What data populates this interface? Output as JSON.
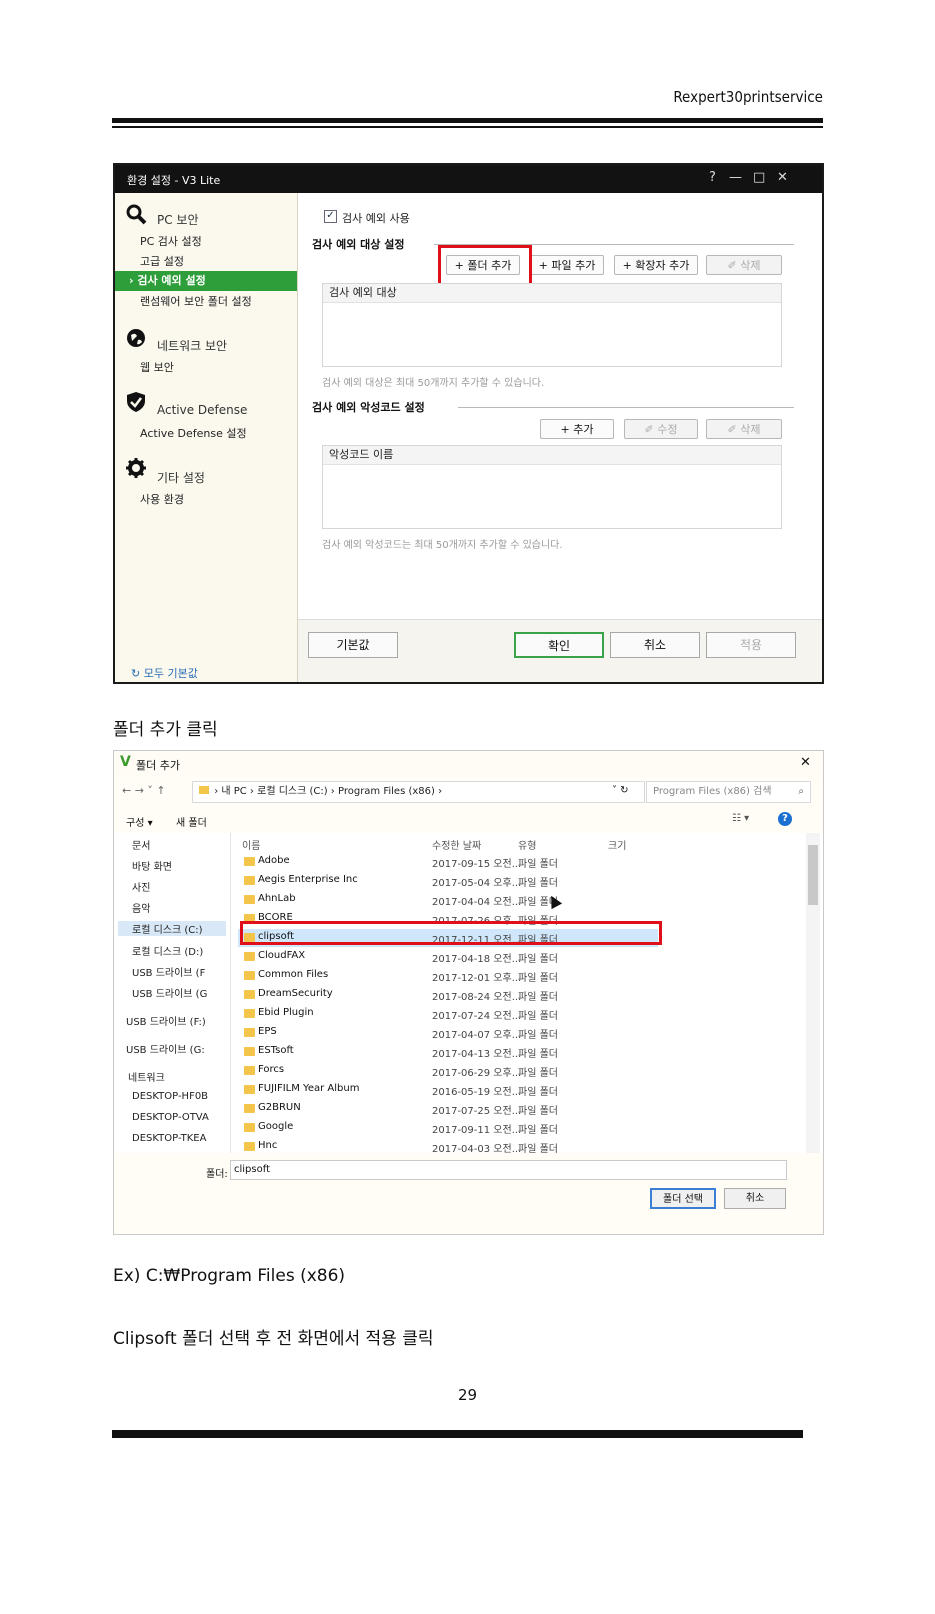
{
  "doc": {
    "header": "Rexpert30printservice",
    "caption1": "폴더 추가 클릭",
    "caption2": "Ex) C:₩Program Files (x86)",
    "caption3": "Clipsoft 폴더 선택 후 전 화면에서 적용 클릭",
    "page_number": "29"
  },
  "v3": {
    "title": "환경 설정 - V3 Lite",
    "controls": [
      "?",
      "—",
      "□",
      "✕"
    ],
    "sidebar": {
      "pc_security": "PC 보안",
      "pc_scan": "PC 검사 설정",
      "advanced": "고급 설정",
      "scan_exceptions": "› 검사 예외 설정",
      "ransomware": "랜섬웨어 보안 폴더 설정",
      "network_security": "네트워크 보안",
      "web_security": "웹 보안",
      "active_defense": "Active Defense",
      "active_defense_settings": "Active Defense 설정",
      "other_settings": "기타 설정",
      "environment": "사용 환경",
      "reset_all": "모두 기본값"
    },
    "main": {
      "use_exceptions_label": "검사 예외 사용",
      "use_exceptions_checked": true,
      "targets_title": "검사 예외 대상 설정",
      "add_folder": "+ 폴더 추가",
      "add_file": "+ 파일 추가",
      "add_extension": "+ 확장자 추가",
      "delete": "✐ 삭제",
      "targets_header": "검사 예외 대상",
      "targets_note": "검사 예외 대상은 최대 50개까지 추가할 수 있습니다.",
      "malware_title": "검사 예외 악성코드 설정",
      "add": "+ 추가",
      "edit": "✐ 수정",
      "delete2": "✐ 삭제",
      "malware_header": "악성코드 이름",
      "malware_note": "검사 예외 악성코드는 최대 50개까지 추가할 수 있습니다."
    },
    "footer": {
      "defaults": "기본값",
      "ok": "확인",
      "cancel": "취소",
      "apply": "적용"
    }
  },
  "dialog": {
    "title": "폴더 추가",
    "close": "✕",
    "nav_arrows": "←  →  ˅  ↑",
    "breadcrumb": "›  내 PC  ›  로컬 디스크 (C:)  ›  Program Files (x86)  ›",
    "search_placeholder": "Program Files (x86) 검색",
    "organize": "구성 ▾",
    "new_folder": "새 폴더",
    "view": "☷ ▾",
    "help": "?",
    "nav_items": [
      "문서",
      "바탕 화면",
      "사진",
      "음악",
      "로컬 디스크 (C:)",
      "로컬 디스크 (D:)",
      "USB 드라이브 (F",
      "USB 드라이브 (G",
      "USB 드라이브 (F:)",
      "USB 드라이브 (G:",
      "네트워크",
      "DESKTOP-HF0B",
      "DESKTOP-OTVA",
      "DESKTOP-TKEA"
    ],
    "columns": {
      "name": "이름",
      "date": "수정한 날짜",
      "type": "유형",
      "size": "크기"
    },
    "files": [
      {
        "name": "Adobe",
        "date": "2017-09-15 오전...",
        "type": "파일 폴더"
      },
      {
        "name": "Aegis Enterprise Inc",
        "date": "2017-05-04 오후...",
        "type": "파일 폴더"
      },
      {
        "name": "AhnLab",
        "date": "2017-04-04 오전...",
        "type": "파일 폴더"
      },
      {
        "name": "BCORE",
        "date": "2017-07-26 오후...",
        "type": "파일 폴더"
      },
      {
        "name": "clipsoft",
        "date": "2017-12-11 오전...",
        "type": "파일 폴더"
      },
      {
        "name": "CloudFAX",
        "date": "2017-04-18 오전...",
        "type": "파일 폴더"
      },
      {
        "name": "Common Files",
        "date": "2017-12-01 오후...",
        "type": "파일 폴더"
      },
      {
        "name": "DreamSecurity",
        "date": "2017-08-24 오전...",
        "type": "파일 폴더"
      },
      {
        "name": "Ebid Plugin",
        "date": "2017-07-24 오전...",
        "type": "파일 폴더"
      },
      {
        "name": "EPS",
        "date": "2017-04-07 오후...",
        "type": "파일 폴더"
      },
      {
        "name": "ESTsoft",
        "date": "2017-04-13 오전...",
        "type": "파일 폴더"
      },
      {
        "name": "Forcs",
        "date": "2017-06-29 오후...",
        "type": "파일 폴더"
      },
      {
        "name": "FUJIFILM Year Album",
        "date": "2016-05-19 오전...",
        "type": "파일 폴더"
      },
      {
        "name": "G2BRUN",
        "date": "2017-07-25 오전...",
        "type": "파일 폴더"
      },
      {
        "name": "Google",
        "date": "2017-09-11 오전...",
        "type": "파일 폴더"
      },
      {
        "name": "Hnc",
        "date": "2017-04-03 오전...",
        "type": "파일 폴더"
      }
    ],
    "folder_label": "폴더:",
    "folder_value": "clipsoft",
    "select_button": "폴더 선택",
    "cancel_button": "취소"
  }
}
